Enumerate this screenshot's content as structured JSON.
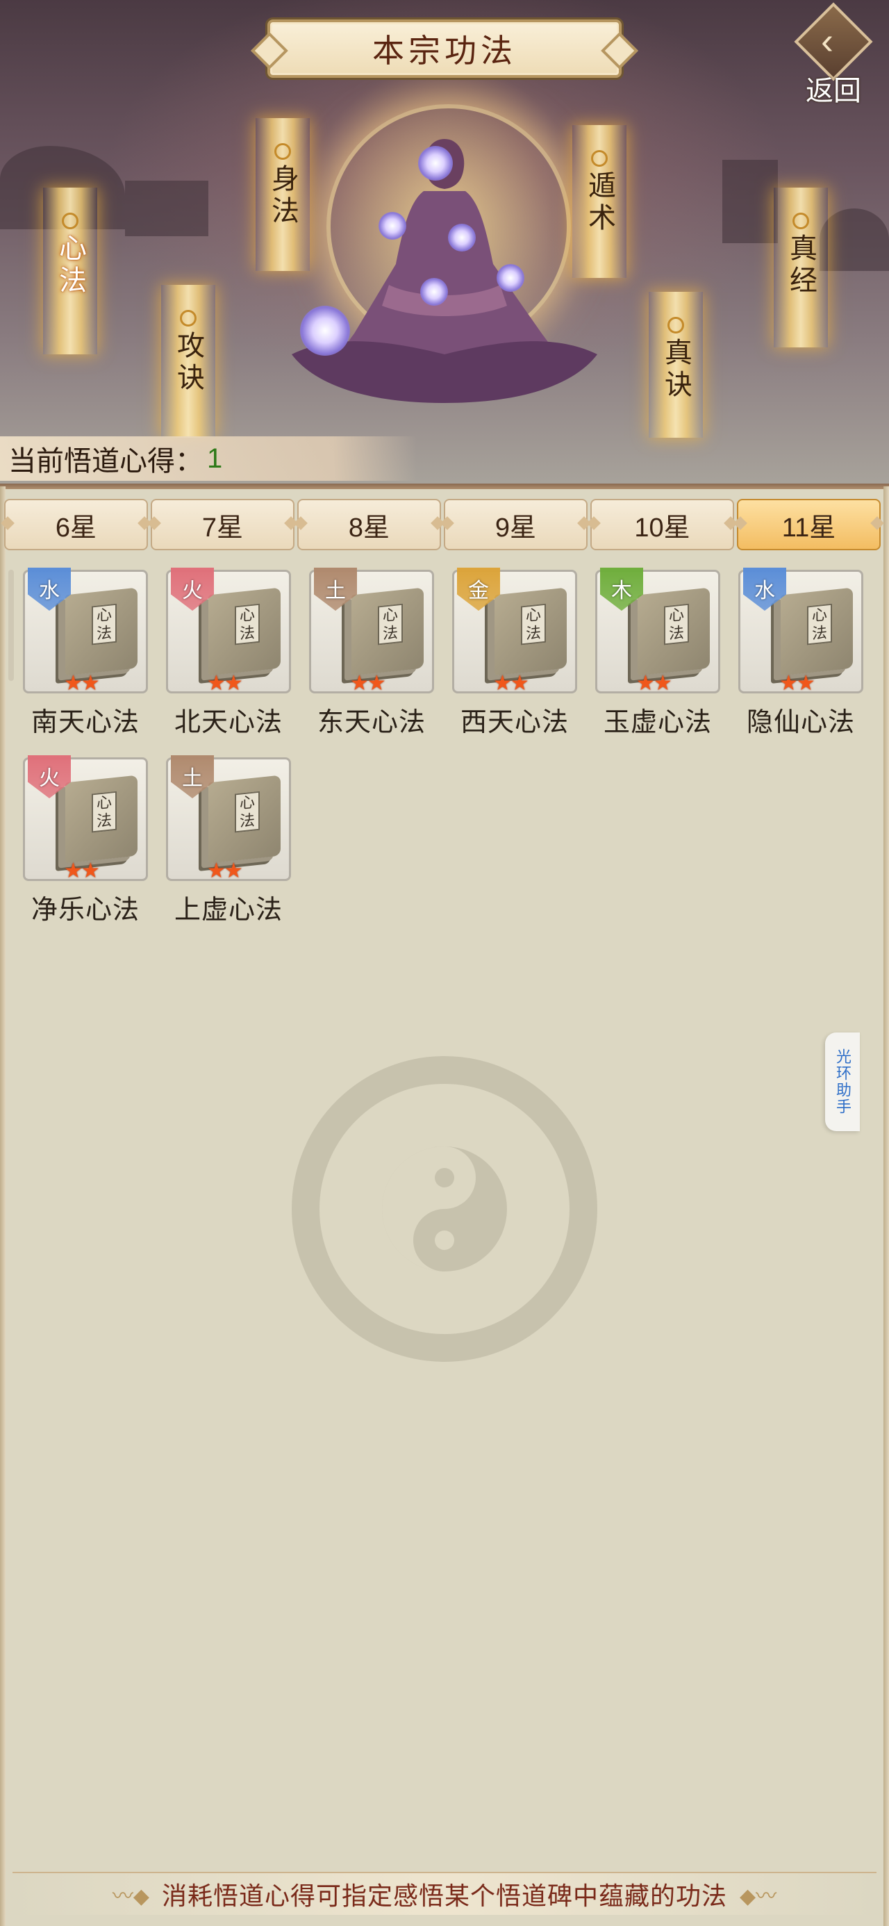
{
  "title": "本宗功法",
  "back_label": "返回",
  "insight": {
    "label": "当前悟道心得：",
    "value": "1"
  },
  "talismans": [
    {
      "label": "心法",
      "active": true
    },
    {
      "label": "攻诀",
      "active": false
    },
    {
      "label": "身法",
      "active": false
    },
    {
      "label": "遁术",
      "active": false
    },
    {
      "label": "真诀",
      "active": false
    },
    {
      "label": "真经",
      "active": false
    }
  ],
  "tabs": [
    {
      "label": "6星",
      "active": false
    },
    {
      "label": "7星",
      "active": false
    },
    {
      "label": "8星",
      "active": false
    },
    {
      "label": "9星",
      "active": false
    },
    {
      "label": "10星",
      "active": false
    },
    {
      "label": "11星",
      "active": true
    }
  ],
  "items": [
    {
      "name": "南天心法",
      "element": "水",
      "element_color": "#5b8ed8",
      "stars": 2
    },
    {
      "name": "北天心法",
      "element": "火",
      "element_color": "#e0707a",
      "stars": 2
    },
    {
      "name": "东天心法",
      "element": "土",
      "element_color": "#b08a6e",
      "stars": 2
    },
    {
      "name": "西天心法",
      "element": "金",
      "element_color": "#dca43a",
      "stars": 2
    },
    {
      "name": "玉虚心法",
      "element": "木",
      "element_color": "#6fae3c",
      "stars": 2
    },
    {
      "name": "隐仙心法",
      "element": "水",
      "element_color": "#5b8ed8",
      "stars": 2
    },
    {
      "name": "净乐心法",
      "element": "火",
      "element_color": "#e0707a",
      "stars": 2
    },
    {
      "name": "上虚心法",
      "element": "土",
      "element_color": "#b08a6e",
      "stars": 2
    }
  ],
  "book_glyph": "心法",
  "helper_label": "光环助手",
  "bottom_note": "消耗悟道心得可指定感悟某个悟道碑中蕴藏的功法",
  "colors": {
    "accent_tab": "#f3bd62",
    "title_text": "#5a2410",
    "star": "#f0571b",
    "note_text": "#7a2a1a",
    "insight_value": "#2e7a18"
  }
}
